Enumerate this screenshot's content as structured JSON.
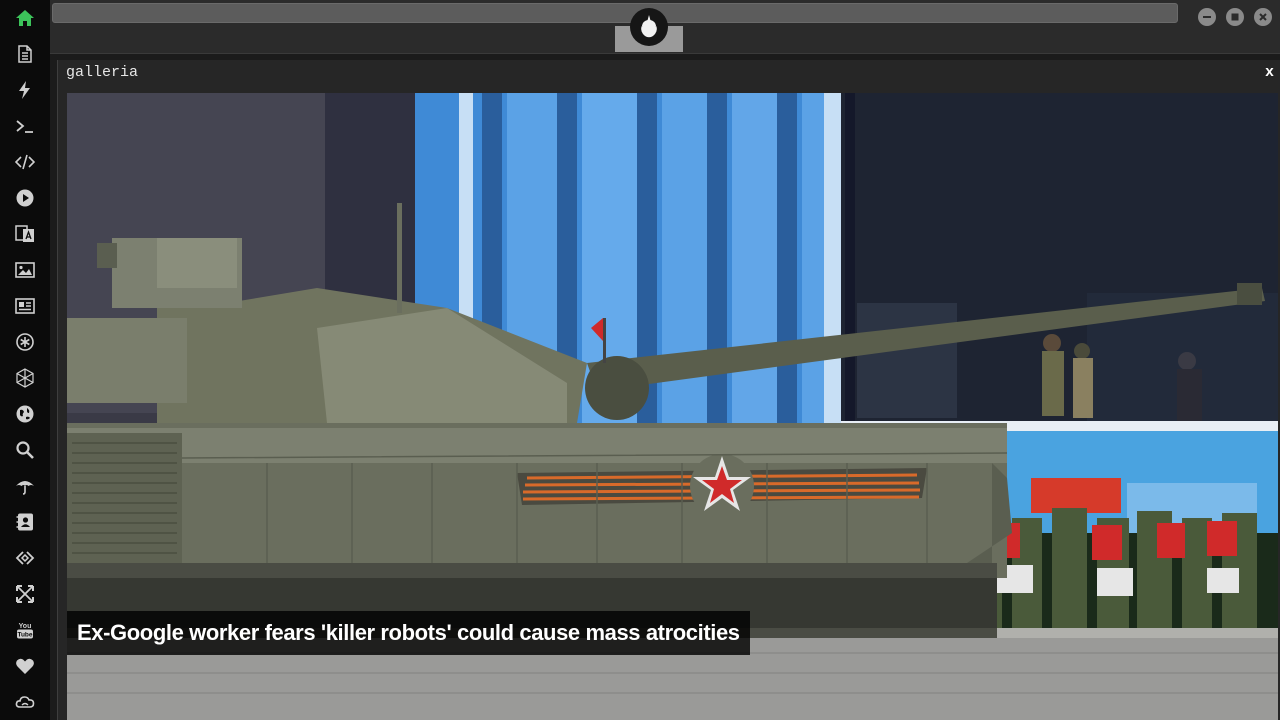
{
  "window": {
    "address_value": "",
    "controls": [
      "minimize-icon",
      "maximize-icon",
      "close-icon"
    ],
    "logo_icon": "rebel-alliance-icon"
  },
  "sidebar": {
    "items": [
      {
        "name": "home-icon",
        "color": "#3cc35a"
      },
      {
        "name": "document-icon"
      },
      {
        "name": "lightning-icon"
      },
      {
        "name": "terminal-icon"
      },
      {
        "name": "code-icon"
      },
      {
        "name": "play-icon"
      },
      {
        "name": "translate-icon"
      },
      {
        "name": "image-icon"
      },
      {
        "name": "news-icon"
      },
      {
        "name": "asterisk-icon"
      },
      {
        "name": "hexagon-icon"
      },
      {
        "name": "globe-icon"
      },
      {
        "name": "search-icon"
      },
      {
        "name": "umbrella-icon"
      },
      {
        "name": "contact-icon"
      },
      {
        "name": "link-icon"
      },
      {
        "name": "expand-icon"
      },
      {
        "name": "youtube-icon"
      },
      {
        "name": "heart-icon"
      },
      {
        "name": "cloud-icon"
      }
    ]
  },
  "gallery": {
    "title": "galleria",
    "close_label": "x",
    "caption": "Ex-Google worker fears 'killer robots' could cause mass atrocities"
  },
  "colors": {
    "accent": "#3cc35a",
    "sidebar_bg": "#0b0b0b",
    "topbar_bg": "#2b2b2b"
  }
}
